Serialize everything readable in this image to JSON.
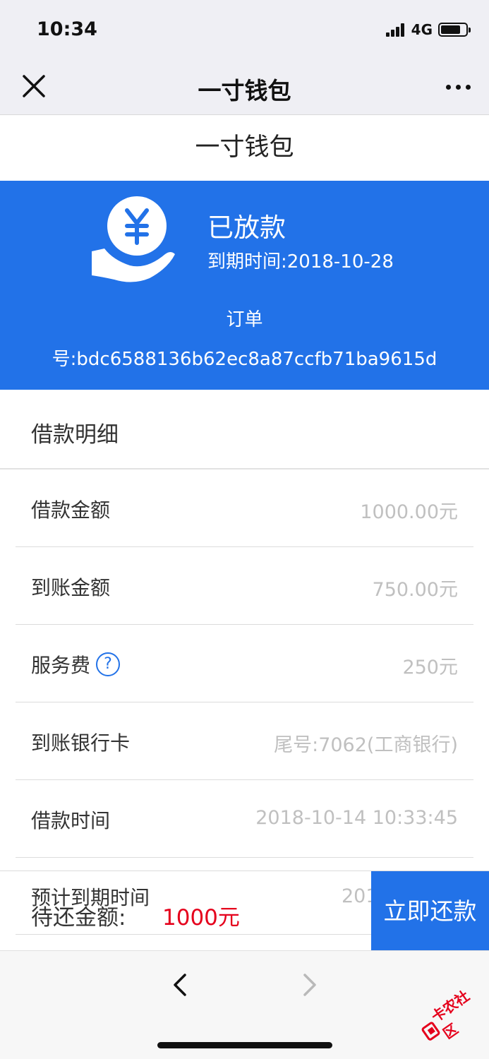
{
  "status_bar": {
    "time": "10:34",
    "network": "4G",
    "battery_level": 0.8
  },
  "nav_bar": {
    "title": "一寸钱包",
    "close_icon": "close-icon",
    "more_icon": "more-dots-icon"
  },
  "page": {
    "header_title": "一寸钱包"
  },
  "banner": {
    "icon": "hand-holding-yuan-icon",
    "status": "已放款",
    "due_date": "到期时间:2018-10-28",
    "order_label": "订单",
    "order_id": "号:bdc6588136b62ec8a87ccfb71ba9615d",
    "background_color": "#2272e8"
  },
  "details": {
    "section_title": "借款明细",
    "rows": [
      {
        "label": "借款金额",
        "value": "1000.00元"
      },
      {
        "label": "到账金额",
        "value": "750.00元"
      },
      {
        "label": "服务费",
        "value": "250元",
        "help_icon": "?"
      },
      {
        "label": "到账银行卡",
        "value": "尾号:7062(工商银行)"
      },
      {
        "label": "借款时间",
        "value": "2018-10-14 10:33:45"
      }
    ],
    "peek_row": {
      "label": "预计到期时间",
      "value": "201"
    }
  },
  "bottom_bar": {
    "pay_label": "待还金额:",
    "pay_amount": "1000元",
    "pay_button": "立即还款",
    "amount_color": "#e5001c"
  },
  "browser_bar": {
    "back_icon": "chevron-left-icon",
    "forward_icon": "chevron-right-icon"
  },
  "watermark": {
    "text": "卡农社区"
  }
}
